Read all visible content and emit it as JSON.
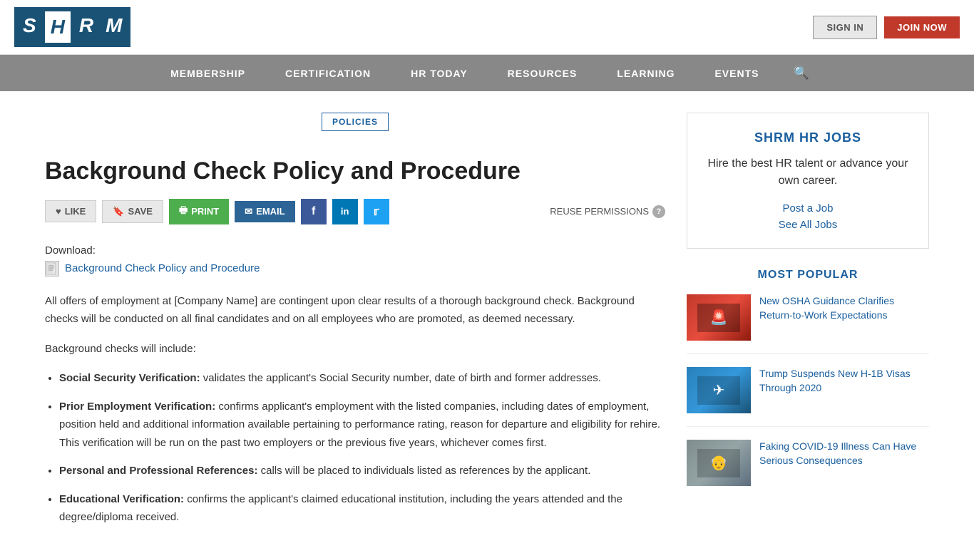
{
  "header": {
    "logo_alt": "SHRM",
    "signin_label": "SIGN IN",
    "join_label": "JOIN NOW"
  },
  "nav": {
    "items": [
      {
        "label": "MEMBERSHIP"
      },
      {
        "label": "CERTIFICATION"
      },
      {
        "label": "HR TODAY"
      },
      {
        "label": "RESOURCES"
      },
      {
        "label": "LEARNING"
      },
      {
        "label": "EVENTS"
      }
    ],
    "search_icon": "🔍"
  },
  "article": {
    "category": "POLICIES",
    "title": "Background Check Policy and Procedure",
    "actions": {
      "like": "LIKE",
      "save": "SAVE",
      "print": "PRINT",
      "email": "EMAIL",
      "reuse": "REUSE PERMISSIONS"
    },
    "download_label": "Download:",
    "download_link_text": "Background Check Policy and Procedure",
    "intro": "All offers of employment at [Company Name] are contingent upon clear results of a thorough background check. Background checks will be conducted on all final candidates and on all employees who are promoted, as deemed necessary.",
    "checks_intro": "Background checks will include:",
    "checks": [
      {
        "term": "Social Security Verification:",
        "description": "validates the applicant's Social Security number, date of birth and former addresses."
      },
      {
        "term": "Prior Employment Verification:",
        "description": "confirms applicant's employment with the listed companies, including dates of employment, position held and additional information available pertaining to performance rating, reason for departure and eligibility for rehire. This verification will be run on the past two employers or the previous five years, whichever comes first."
      },
      {
        "term": "Personal and Professional References:",
        "description": "calls will be placed to individuals listed as references by the applicant."
      },
      {
        "term": "Educational Verification:",
        "description": "confirms the applicant's claimed educational institution, including the years attended and the degree/diploma received."
      }
    ]
  },
  "sidebar": {
    "jobs_title": "SHRM HR JOBS",
    "jobs_text": "Hire the best HR talent or advance your own career.",
    "post_job": "Post a Job",
    "see_all_jobs": "See All Jobs",
    "popular_title": "MOST POPULAR",
    "popular_articles": [
      {
        "title": "New OSHA Guidance Clarifies Return-to-Work Expectations",
        "thumb_color": "#c0392b"
      },
      {
        "title": "Trump Suspends New H-1B Visas Through 2020",
        "thumb_color": "#2980b9"
      },
      {
        "title": "Faking COVID-19 Illness Can Have Serious Consequences",
        "thumb_color": "#7f8c8d"
      }
    ]
  }
}
